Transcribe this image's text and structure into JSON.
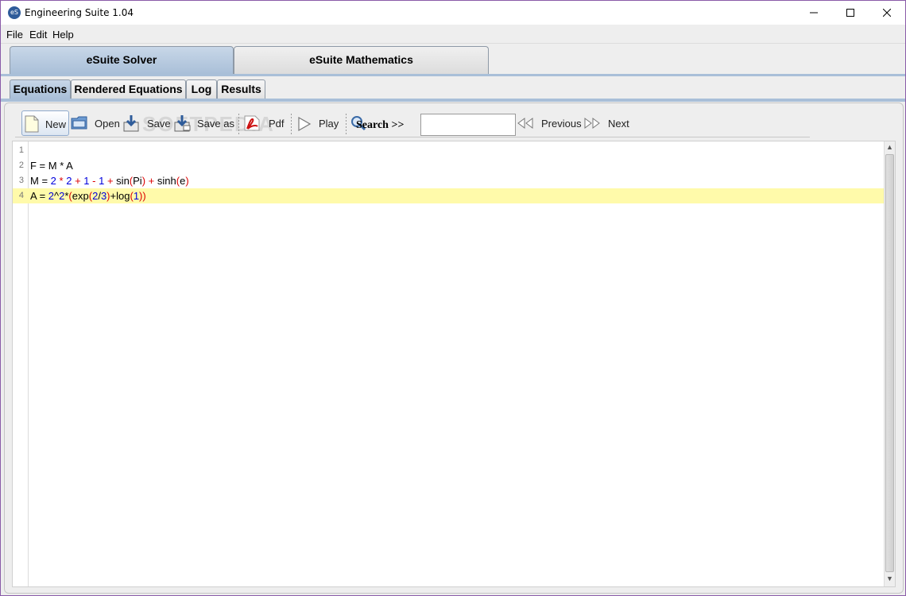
{
  "window": {
    "title": "Engineering Suite 1.04",
    "icon_text": "eS"
  },
  "menu": {
    "items": [
      "File",
      "Edit",
      "Help"
    ]
  },
  "main_tabs": [
    {
      "label": "eSuite Solver",
      "selected": true
    },
    {
      "label": "eSuite Mathematics",
      "selected": false
    }
  ],
  "sub_tabs": [
    {
      "label": "Equations",
      "selected": true
    },
    {
      "label": "Rendered Equations",
      "selected": false
    },
    {
      "label": "Log",
      "selected": false
    },
    {
      "label": "Results",
      "selected": false
    }
  ],
  "toolbar": {
    "new_label": "New",
    "open_label": "Open",
    "save_label": "Save",
    "save_as_label": "Save as",
    "pdf_label": "Pdf",
    "play_label": "Play",
    "search_label": "Search >>",
    "search_value": "",
    "previous_label": "Previous",
    "next_label": "Next"
  },
  "watermark": "SOFTPEDIA",
  "editor": {
    "current_line": 4,
    "lines": [
      {
        "number": "1",
        "text": ""
      },
      {
        "number": "2",
        "text": "F = M * A"
      },
      {
        "number": "3",
        "text": "M = 2 * 2 + 1 - 1 + sin(Pi) + sinh(e)"
      },
      {
        "number": "4",
        "text": "A = 2^2*(exp(2/3)+log(1))"
      }
    ]
  },
  "colors": {
    "tab_selected": "#a9bfd8",
    "current_line_highlight": "#fffaaa",
    "number_token": "#0000dd",
    "paren_token": "#dd0000"
  }
}
